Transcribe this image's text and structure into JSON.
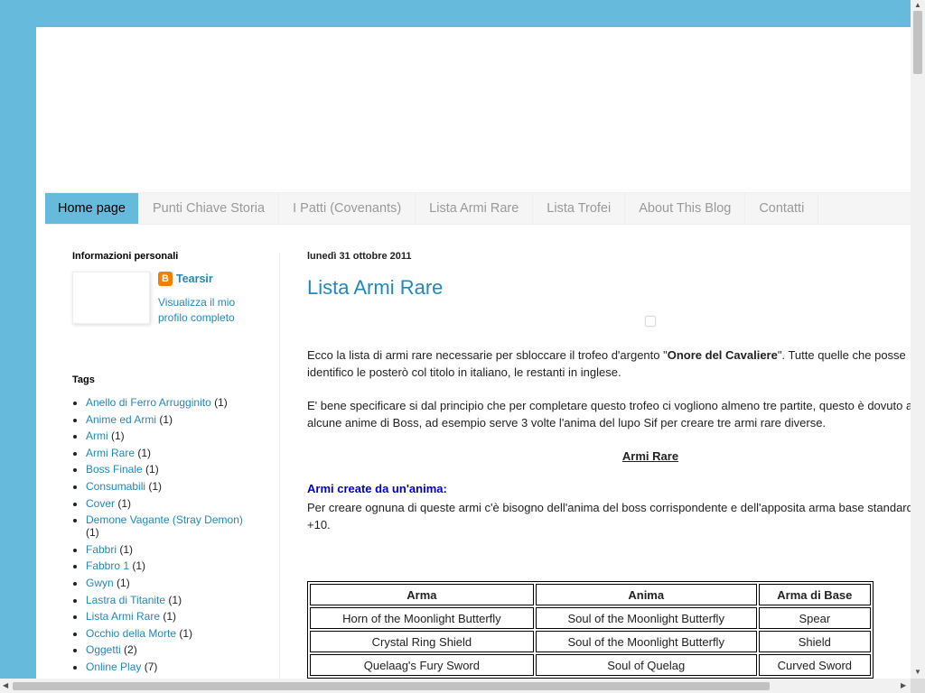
{
  "nav": {
    "tabs": [
      {
        "label": "Home page"
      },
      {
        "label": "Punti Chiave Storia"
      },
      {
        "label": "I Patti (Covenants)"
      },
      {
        "label": "Lista Armi Rare"
      },
      {
        "label": "Lista Trofei"
      },
      {
        "label": "About This Blog"
      },
      {
        "label": "Contatti"
      }
    ]
  },
  "sidebar": {
    "profile": {
      "title": "Informazioni personali",
      "name": "Tearsir",
      "link": "Visualizza il mio profilo completo"
    },
    "tags": {
      "title": "Tags",
      "items": [
        {
          "label": "Anello di Ferro Arrugginito",
          "count": "(1)"
        },
        {
          "label": "Anime ed Armi",
          "count": "(1)"
        },
        {
          "label": "Armi",
          "count": "(1)"
        },
        {
          "label": "Armi Rare",
          "count": "(1)"
        },
        {
          "label": "Boss Finale",
          "count": "(1)"
        },
        {
          "label": "Consumabili",
          "count": "(1)"
        },
        {
          "label": "Cover",
          "count": "(1)"
        },
        {
          "label": "Demone Vagante (Stray Demon)",
          "count": "(1)"
        },
        {
          "label": "Fabbri",
          "count": "(1)"
        },
        {
          "label": "Fabbro 1",
          "count": "(1)"
        },
        {
          "label": "Gwyn",
          "count": "(1)"
        },
        {
          "label": "Lastra di Titanite",
          "count": "(1)"
        },
        {
          "label": "Lista Armi Rare",
          "count": "(1)"
        },
        {
          "label": "Occhio della Morte",
          "count": "(1)"
        },
        {
          "label": "Oggetti",
          "count": "(2)"
        },
        {
          "label": "Online Play",
          "count": "(7)"
        }
      ]
    }
  },
  "post": {
    "date": "lunedì 31 ottobre 2011",
    "title": "Lista Armi Rare",
    "p1": {
      "pre": "Ecco la lista di armi rare necessarie per sbloccare il trofeo d'argento \"",
      "bold": "Onore del Cavaliere",
      "post": "\". Tutte quelle che posse",
      "line2": "identifico le posterò col titolo in italiano, le restanti in inglese."
    },
    "p2": {
      "line1": "E' bene specificare si dal principio che per completare questo trofeo ci vogliono almeno tre partite, questo è dovuto a",
      "line2": "alcune anime di Boss, ad esempio serve 3 volte l'anima del lupo Sif per creare tre armi rare diverse."
    },
    "section_title": "Armi Rare",
    "subsection_title": "Armi create da un'anima:",
    "p3": {
      "line1": "Per creare ognuna di queste armi c'è bisogno dell'anima del boss corrispondente e dell'apposita arma base standard",
      "line2": "+10."
    },
    "table": {
      "headers": [
        "Arma",
        "Anima",
        "Arma di Base"
      ],
      "rows": [
        [
          "Horn of the Moonlight Butterfly",
          "Soul of the Moonlight Butterfly",
          "Spear"
        ],
        [
          "Crystal Ring Shield",
          "Soul of the Moonlight Butterfly",
          "Shield"
        ],
        [
          "Quelaag's Fury Sword",
          "Soul of Quelag",
          "Curved Sword"
        ]
      ]
    }
  },
  "colors": {
    "background": "#66bbdd",
    "link": "#2288bb",
    "subsection": "#0000cc",
    "nav_active": "#66bbdd"
  }
}
